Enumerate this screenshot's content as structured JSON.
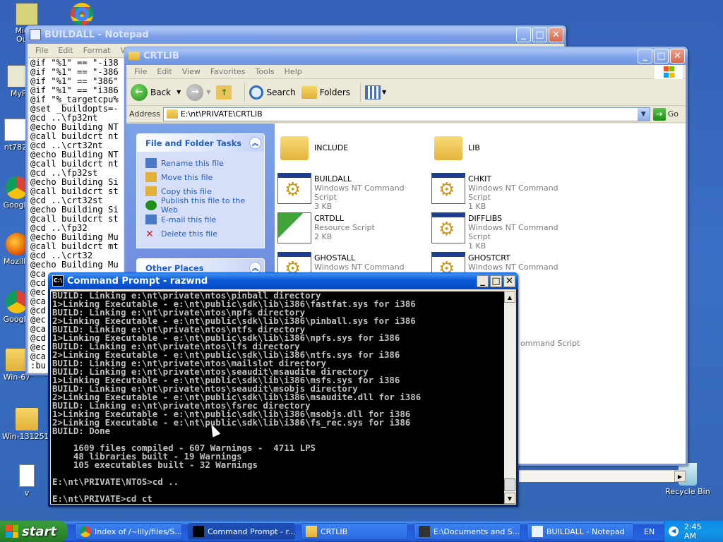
{
  "desktop": {
    "icons": [
      {
        "label": "Micr Out",
        "kind": "generic"
      },
      {
        "label": "",
        "kind": "chrome"
      },
      {
        "label": "MyF",
        "kind": "generic"
      },
      {
        "label": "nt782",
        "kind": "generic"
      },
      {
        "label": "Google",
        "kind": "chrome"
      },
      {
        "label": "Mozilla",
        "kind": "firefox"
      },
      {
        "label": "Google",
        "kind": "chrome"
      },
      {
        "label": "Win-67",
        "kind": "folder"
      },
      {
        "label": "Win-131251.",
        "kind": "folder"
      },
      {
        "label": "v",
        "kind": "doc"
      },
      {
        "label": "Recycle Bin",
        "kind": "recycle"
      }
    ]
  },
  "notepad": {
    "title": "BUILDALL - Notepad",
    "menu": [
      "File",
      "Edit",
      "Format",
      "View"
    ],
    "lines": [
      "@if \"%1\" == \"-i38",
      "@if \"%1\" == \"-386",
      "@if \"%1\" == \"386\"",
      "@if \"%1\" == \"i386",
      "@if \"%_targetcpu%",
      "@set _buildopts=-",
      "@cd ..\\fp32nt",
      "@echo Building NT",
      "@call buildcrt nt",
      "@cd ..\\crt32nt",
      "@echo Building NT",
      "@call buildcrt nt",
      "@cd ..\\fp32st",
      "@echo Building Si",
      "@call buildcrt st",
      "@cd ..\\crt32st",
      "@echo Building Si",
      "@call buildcrt st",
      "@cd ..\\fp32",
      "@echo Building Mu",
      "@call buildcrt mt",
      "@cd ..\\crt32",
      "@echo Building Mu",
      "@ca",
      "@cd",
      "@ec",
      "@ca",
      "@cd",
      "@ec",
      "@ca",
      "@cd",
      "@ec",
      "@ca",
      ":bu"
    ]
  },
  "explorer": {
    "title": "CRTLIB",
    "menu": [
      "File",
      "Edit",
      "View",
      "Favorites",
      "Tools",
      "Help"
    ],
    "toolbar": {
      "back": "Back",
      "search": "Search",
      "folders": "Folders"
    },
    "address_label": "Address",
    "address": "E:\\nt\\PRIVATE\\CRTLIB",
    "go": "Go",
    "tasks_title": "File and Folder Tasks",
    "tasks": [
      {
        "label": "Rename this file",
        "icon": "rename-icon"
      },
      {
        "label": "Move this file",
        "icon": "move-icon"
      },
      {
        "label": "Copy this file",
        "icon": "copy-icon"
      },
      {
        "label": "Publish this file to the Web",
        "icon": "globe-icon"
      },
      {
        "label": "E-mail this file",
        "icon": "email-icon"
      },
      {
        "label": "Delete this file",
        "icon": "delete-icon"
      }
    ],
    "other_places_title": "Other Places",
    "files": [
      {
        "name": "INCLUDE",
        "type": "",
        "size": "",
        "kind": "folder"
      },
      {
        "name": "LIB",
        "type": "",
        "size": "",
        "kind": "folder"
      },
      {
        "name": "BUILDALL",
        "type": "Windows NT Command Script",
        "size": "3 KB",
        "kind": "script"
      },
      {
        "name": "CHKIT",
        "type": "Windows NT Command Script",
        "size": "1 KB",
        "kind": "script"
      },
      {
        "name": "CRTDLL",
        "type": "Resource Script",
        "size": "2 KB",
        "kind": "res"
      },
      {
        "name": "DIFFLIBS",
        "type": "Windows NT Command Script",
        "size": "1 KB",
        "kind": "script"
      },
      {
        "name": "GHOSTALL",
        "type": "Windows NT Command Script",
        "size": "",
        "kind": "script"
      },
      {
        "name": "GHOSTCRT",
        "type": "Windows NT Command Script",
        "size": "",
        "kind": "script"
      }
    ],
    "partial_text": "ommand Script"
  },
  "cmd": {
    "title": "Command Prompt - razwnd",
    "lines": [
      "BUILD: Linking e:\\nt\\private\\ntos\\pinball directory",
      "1>Linking Executable - e:\\nt\\public\\sdk\\lib\\i386\\fastfat.sys for i386",
      "BUILD: Linking e:\\nt\\private\\ntos\\npfs directory",
      "2>Linking Executable - e:\\nt\\public\\sdk\\lib\\i386\\pinball.sys for i386",
      "BUILD: Linking e:\\nt\\private\\ntos\\ntfs directory",
      "1>Linking Executable - e:\\nt\\public\\sdk\\lib\\i386\\npfs.sys for i386",
      "BUILD: Linking e:\\nt\\private\\ntos\\lfs directory",
      "2>Linking Executable - e:\\nt\\public\\sdk\\lib\\i386\\ntfs.sys for i386",
      "BUILD: Linking e:\\nt\\private\\ntos\\mailslot directory",
      "BUILD: Linking e:\\nt\\private\\ntos\\seaudit\\msaudite directory",
      "1>Linking Executable - e:\\nt\\public\\sdk\\lib\\i386\\msfs.sys for i386",
      "BUILD: Linking e:\\nt\\private\\ntos\\seaudit\\msobjs directory",
      "2>Linking Executable - e:\\nt\\public\\sdk\\lib\\i386\\msaudite.dll for i386",
      "BUILD: Linking e:\\nt\\private\\ntos\\fsrec directory",
      "1>Linking Executable - e:\\nt\\public\\sdk\\lib\\i386\\msobjs.dll for i386",
      "2>Linking Executable - e:\\nt\\public\\sdk\\lib\\i386\\fs_rec.sys for i386",
      "BUILD: Done",
      "",
      "    1609 files compiled - 607 Warnings -  4711 LPS",
      "    48 libraries built - 19 Warnings",
      "    105 executables built - 32 Warnings",
      "",
      "E:\\nt\\PRIVATE\\NTOS>cd ..",
      "",
      "E:\\nt\\PRIVATE>cd ct"
    ]
  },
  "taskbar": {
    "start": "start",
    "tasks": [
      {
        "label": "Index of /~lily/files/S...",
        "icon": "chrome-icon"
      },
      {
        "label": "Command Prompt - r...",
        "icon": "cmd-icon"
      },
      {
        "label": "CRTLIB",
        "icon": "folder-icon"
      },
      {
        "label": "E:\\Documents and S...",
        "icon": "sevenzip-icon"
      },
      {
        "label": "BUILDALL - Notepad",
        "icon": "notepad-icon"
      }
    ],
    "lang": "EN",
    "clock": "2:45 AM"
  }
}
